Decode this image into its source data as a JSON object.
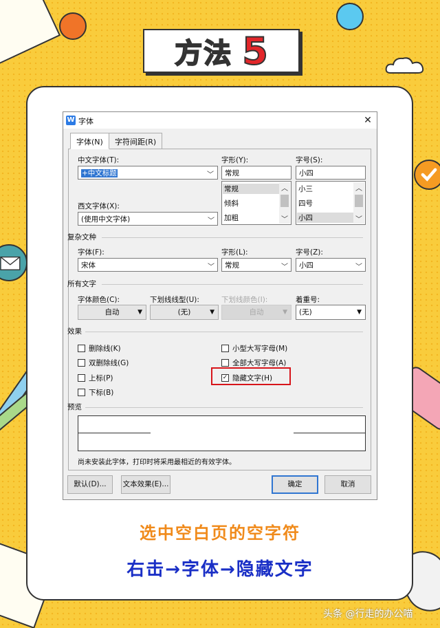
{
  "banner": {
    "title": "方法",
    "number": "5"
  },
  "dialog": {
    "title": "字体",
    "app_icon_letter": "W",
    "close": "✕",
    "tabs": [
      "字体(N)",
      "字符间距(R)"
    ],
    "cn_font": {
      "label": "中文字体(T):",
      "value": "+中文标题"
    },
    "style": {
      "label": "字形(Y):",
      "value": "常规",
      "options": [
        "常规",
        "倾斜",
        "加粗"
      ],
      "selected": "常规"
    },
    "size": {
      "label": "字号(S):",
      "value": "小四",
      "options": [
        "小三",
        "四号",
        "小四"
      ],
      "selected": "小四"
    },
    "west_font": {
      "label": "西文字体(X):",
      "value": "(使用中文字体)"
    },
    "complex_group": "复杂文种",
    "complex_font": {
      "label": "字体(F):",
      "value": "宋体"
    },
    "complex_style": {
      "label": "字形(L):",
      "value": "常规"
    },
    "complex_size": {
      "label": "字号(Z):",
      "value": "小四"
    },
    "all_text_group": "所有文字",
    "font_color": {
      "label": "字体颜色(C):",
      "value": "自动"
    },
    "underline_type": {
      "label": "下划线线型(U):",
      "value": "(无)"
    },
    "underline_color": {
      "label": "下划线颜色(I):",
      "value": "自动"
    },
    "emphasis": {
      "label": "着重号:",
      "value": "(无)"
    },
    "effects_group": "效果",
    "effects": {
      "strikethrough": {
        "label": "删除线(K)",
        "checked": false
      },
      "double_strike": {
        "label": "双删除线(G)",
        "checked": false
      },
      "superscript": {
        "label": "上标(P)",
        "checked": false
      },
      "subscript": {
        "label": "下标(B)",
        "checked": false
      },
      "small_caps": {
        "label": "小型大写字母(M)",
        "checked": false
      },
      "all_caps": {
        "label": "全部大写字母(A)",
        "checked": false
      },
      "hidden": {
        "label": "隐藏文字(H)",
        "checked": true
      }
    },
    "check_mark": "✓",
    "preview_group": "预览",
    "preview_note": "尚未安装此字体，打印时将采用最相近的有效字体。",
    "buttons": {
      "default": "默认(D)...",
      "text_effects": "文本效果(E)...",
      "ok": "确定",
      "cancel": "取消"
    },
    "arrows": {
      "down": "﹀",
      "tri": "▼",
      "up": "︿"
    }
  },
  "captions": {
    "line1": "选中空白页的空字符",
    "line2": "右击→字体→隐藏文字"
  },
  "watermark": "头条 @行走的办公喵",
  "colors": {
    "background": "#f9cc3c",
    "highlight": "#d7141a",
    "caption1": "#f08a1a",
    "caption2": "#1a2fc6"
  }
}
